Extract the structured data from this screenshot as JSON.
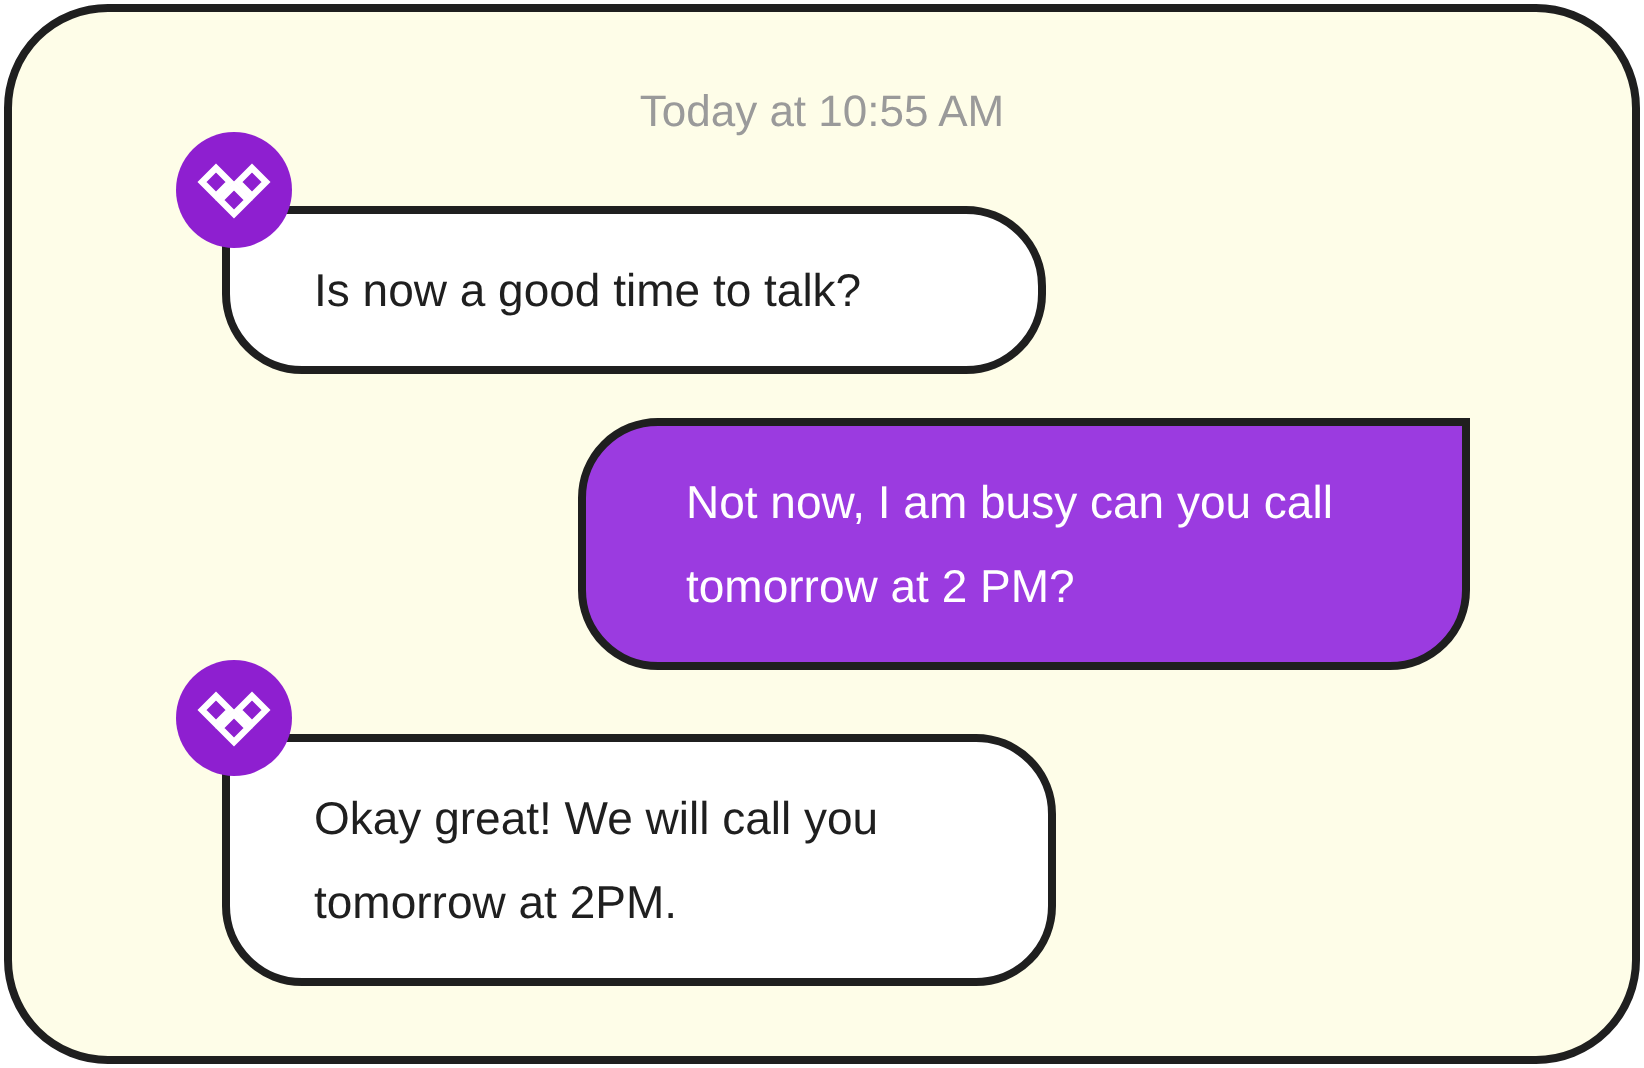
{
  "timestamp": "Today at 10:55 AM",
  "messages": [
    {
      "kind": "received",
      "text": "Is now a good time to talk?"
    },
    {
      "kind": "sent",
      "text": "Not now, I am busy can you call tomorrow at 2 PM?"
    },
    {
      "kind": "received",
      "text": "Okay great! We will call you tomorrow at 2PM."
    }
  ]
}
